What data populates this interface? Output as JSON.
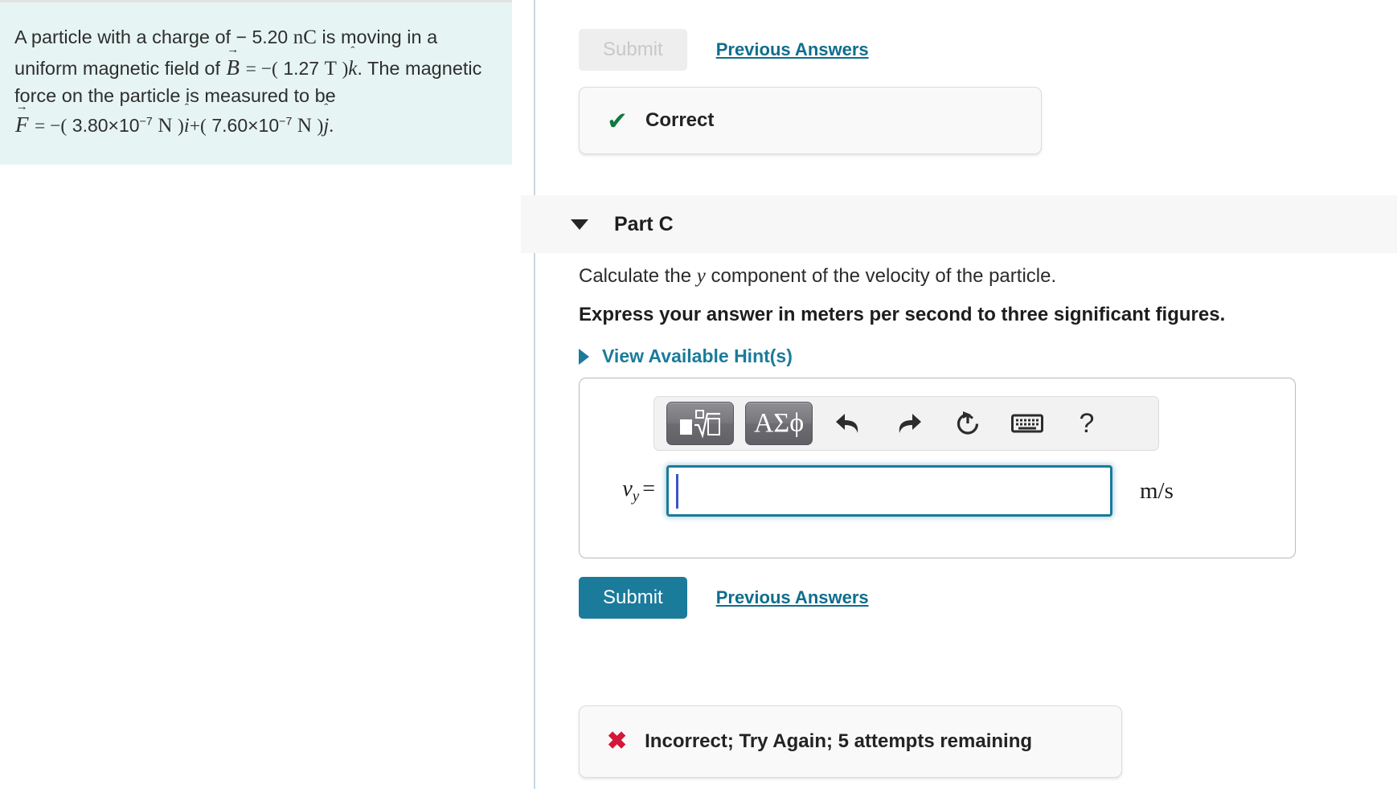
{
  "problem": {
    "intro_1": "A particle with a charge of",
    "charge_value": "− 5.20",
    "charge_unit": "nC",
    "intro_2": "is moving in a uniform magnetic field of",
    "b_symbol": "B",
    "b_equals": "= −(",
    "b_value": "1.27",
    "b_unit": "T",
    "b_close": ")",
    "b_hat": "k",
    "intro_3": ". The magnetic force on the particle is measured to be",
    "f_symbol": "F",
    "f_equals": "= −(",
    "f_x_value": "3.80×10",
    "f_x_exponent": "−7",
    "f_unit": "N",
    "f_close_1": ")",
    "f_hat_i": "i",
    "f_plus": "+(",
    "f_y_value": "7.60×10",
    "f_y_exponent": "−7",
    "f_close_2": ")",
    "f_hat_j": "j",
    "f_period": "."
  },
  "part_b_result": {
    "submit_label": "Submit",
    "previous_answers_label": "Previous Answers",
    "feedback_icon": "check-mark",
    "feedback_text": "Correct"
  },
  "part_c": {
    "header_title": "Part C",
    "caret_icon": "caret-down-icon",
    "question": "Calculate the",
    "question_italic": "y",
    "question_rest": "component of the velocity of the particle.",
    "express_instruction": "Express your answer in meters per second to three significant figures.",
    "hint_caret_icon": "caret-right-icon",
    "hint_label": "View Available Hint(s)",
    "toolbar": {
      "template_button": "template-root-icon",
      "greek_button": "ΑΣϕ",
      "undo_icon": "undo-arrow-icon",
      "redo_icon": "redo-arrow-icon",
      "reset_icon": "reset-circular-arrow-icon",
      "keyboard_icon": "keyboard-icon",
      "help_icon": "?"
    },
    "answer": {
      "variable": "v",
      "variable_subscript": "y",
      "equals": "=",
      "value": "",
      "units": "m/s"
    },
    "submit_label": "Submit",
    "previous_answers_label": "Previous Answers",
    "feedback_icon": "cross-mark",
    "feedback_text": "Incorrect; Try Again; 5 attempts remaining"
  },
  "colors": {
    "accent_teal": "#1a7b9b",
    "link_teal": "#0f6e8c",
    "correct_green": "#107a3d",
    "incorrect_red": "#d3183a",
    "problem_bg": "#e6f5f3",
    "panel_bg": "#f7f7f7"
  }
}
